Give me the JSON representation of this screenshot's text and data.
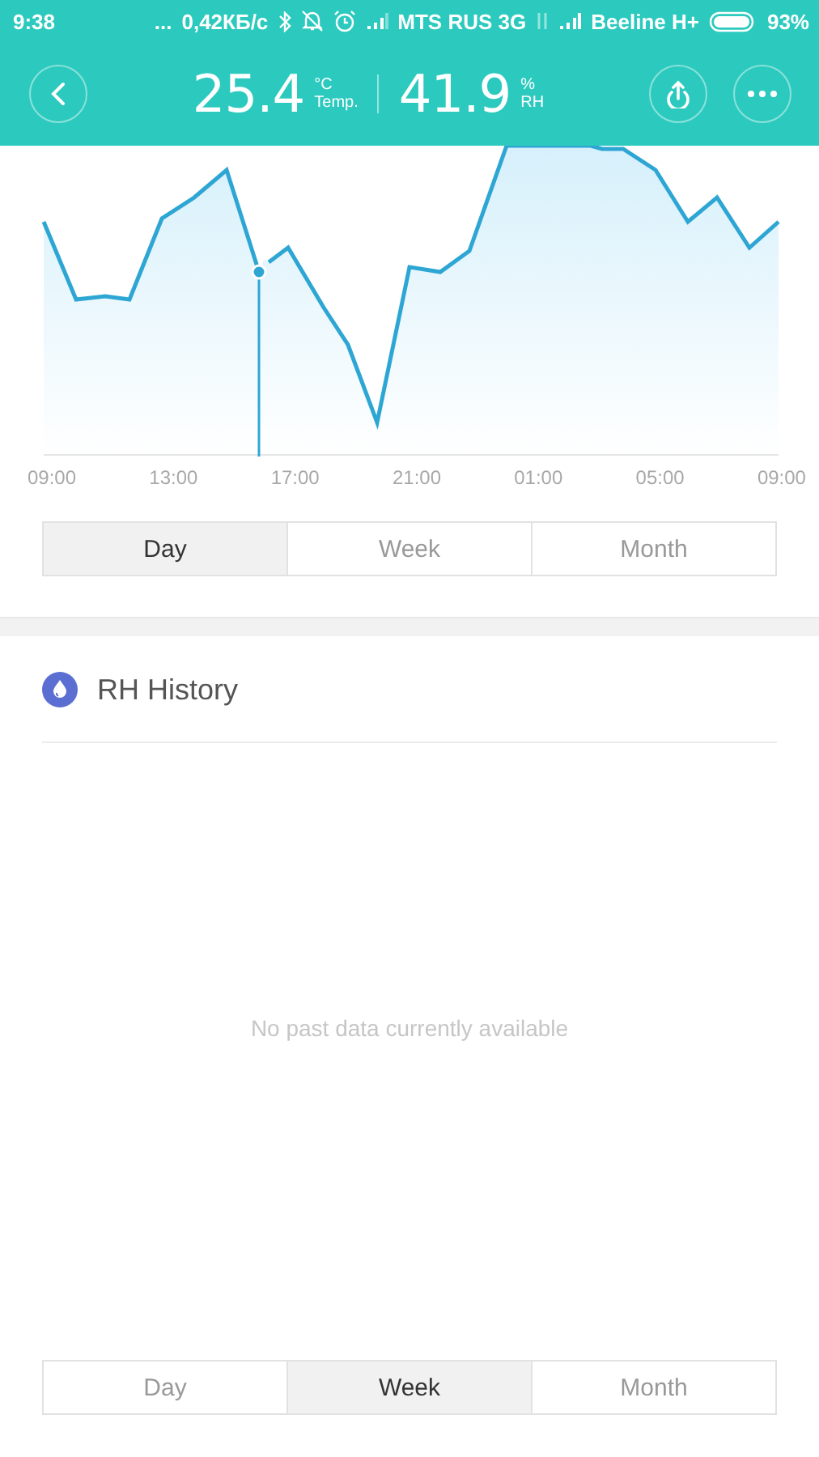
{
  "status_bar": {
    "time": "9:38",
    "dots": "...",
    "speed": "0,42КБ/с",
    "carrier_1": "MTS RUS 3G",
    "carrier_2": "Beeline H+",
    "battery": "93%"
  },
  "header": {
    "readings": [
      {
        "value": "25.4",
        "unit": "°C",
        "label": "Temp."
      },
      {
        "value": "41.9",
        "unit": "%",
        "label": "RH"
      }
    ]
  },
  "chart": {
    "time_labels": [
      "09:00",
      "13:00",
      "17:00",
      "21:00",
      "01:00",
      "05:00",
      "09:00"
    ]
  },
  "range_tabs": [
    {
      "label": "Day",
      "selected": true
    },
    {
      "label": "Week",
      "selected": false
    },
    {
      "label": "Month",
      "selected": false
    }
  ],
  "history": {
    "title": "RH History",
    "empty_message": "No past data currently available",
    "tabs": [
      {
        "label": "Day",
        "selected": false
      },
      {
        "label": "Week",
        "selected": true
      },
      {
        "label": "Month",
        "selected": false
      }
    ]
  }
}
